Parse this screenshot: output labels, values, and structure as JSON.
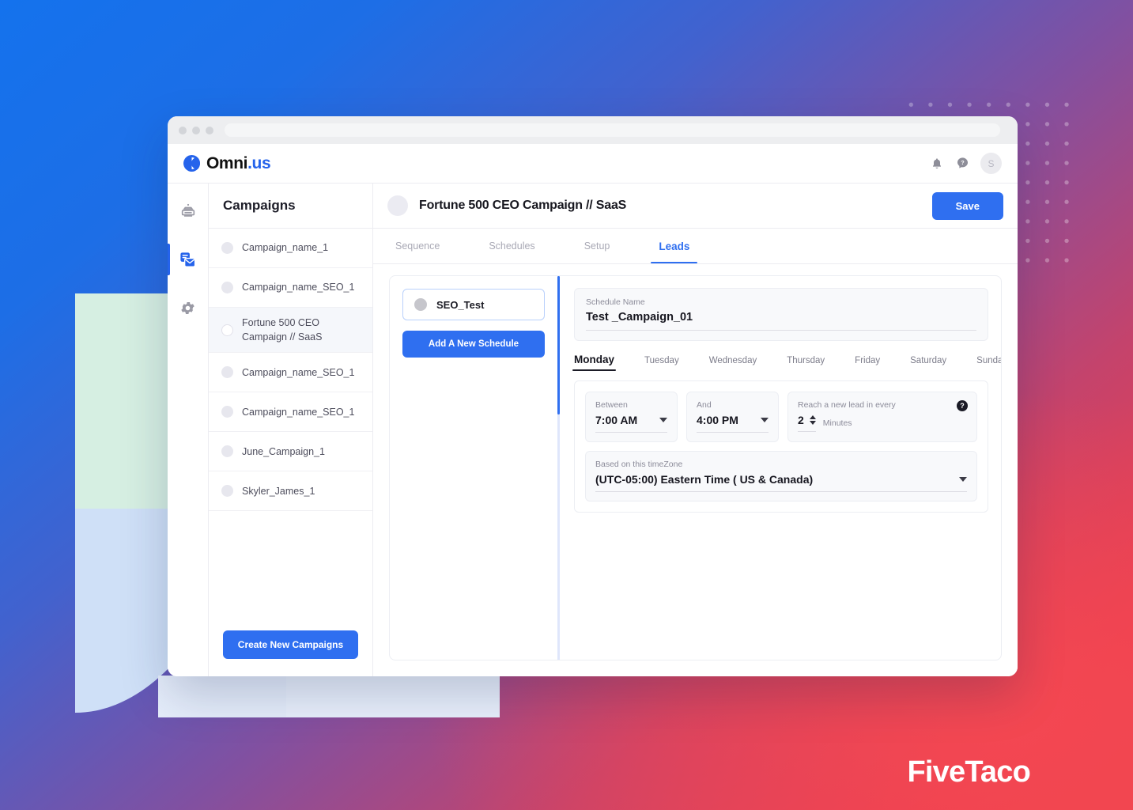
{
  "brand": {
    "logo_name": "Omni",
    "logo_suffix": ".us",
    "watermark": "FiveTaco",
    "accent_color": "#2f6ff0",
    "bg_from": "#1472ED",
    "bg_to": "#F0424E"
  },
  "header": {
    "notifications_icon": "bell-icon",
    "help_icon": "help-chat-icon",
    "avatar_initial": "S"
  },
  "rail": {
    "items": [
      {
        "icon": "printer-icon",
        "name": "printer",
        "active": false
      },
      {
        "icon": "mail-campaign-icon",
        "name": "campaigns",
        "active": true
      },
      {
        "icon": "gear-icon",
        "name": "settings",
        "active": false
      }
    ]
  },
  "sidebar": {
    "title": "Campaigns",
    "create_button": "Create New Campaigns",
    "items": [
      {
        "label": "Campaign_name_1",
        "selected": false
      },
      {
        "label": "Campaign_name_SEO_1",
        "selected": false
      },
      {
        "label": "Fortune 500 CEO Campaign // SaaS",
        "selected": true
      },
      {
        "label": "Campaign_name_SEO_1",
        "selected": false
      },
      {
        "label": "Campaign_name_SEO_1",
        "selected": false
      },
      {
        "label": "June_Campaign_1",
        "selected": false
      },
      {
        "label": "Skyler_James_1",
        "selected": false
      }
    ]
  },
  "main": {
    "campaign_title": "Fortune 500 CEO Campaign // SaaS",
    "save_label": "Save",
    "tabs": [
      {
        "label": "Sequence",
        "active": false
      },
      {
        "label": "Schedules",
        "active": false
      },
      {
        "label": "Setup",
        "active": false
      },
      {
        "label": "Leads",
        "active": true
      }
    ]
  },
  "leads": {
    "schedule_chip": "SEO_Test",
    "add_schedule_label": "Add A New Schedule",
    "schedule_name_label": "Schedule Name",
    "schedule_name_value": "Test _Campaign_01",
    "days": [
      {
        "label": "Monday",
        "active": true
      },
      {
        "label": "Tuesday",
        "active": false
      },
      {
        "label": "Wednesday",
        "active": false
      },
      {
        "label": "Thursday",
        "active": false
      },
      {
        "label": "Friday",
        "active": false
      },
      {
        "label": "Saturday",
        "active": false
      },
      {
        "label": "Sunday",
        "active": false
      }
    ],
    "between_label": "Between",
    "between_value": "7:00 AM",
    "and_label": "And",
    "and_value": "4:00 PM",
    "reach_label": "Reach a new lead in every",
    "reach_value": "2",
    "reach_unit": "Minutes",
    "help_glyph": "?",
    "timezone_label": "Based on this timeZone",
    "timezone_value": "(UTC-05:00) Eastern Time ( US & Canada)"
  }
}
